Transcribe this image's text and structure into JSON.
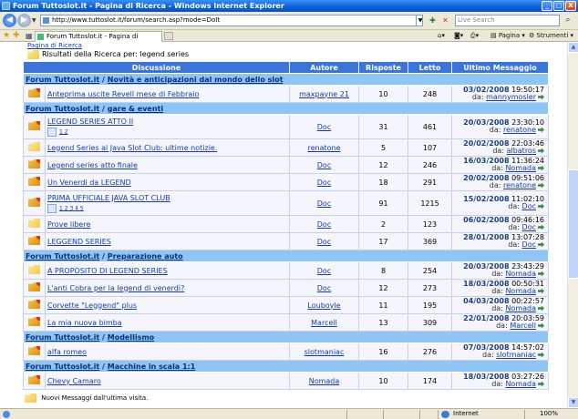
{
  "window": {
    "title": "Forum Tuttoslot.it - Pagina di Ricerca - Windows Internet Explorer",
    "minimize": "_",
    "maximize": "□",
    "close": "X"
  },
  "addressbar": {
    "url": "http://www.tuttoslot.it/forum/search.asp?mode=DoIt",
    "search_placeholder": "Live Search"
  },
  "tabs": [
    {
      "label": "Forum Tuttoslot.it - Pagina di Ricerca"
    }
  ],
  "commands": {
    "page": "Pagina",
    "tools": "Strumenti"
  },
  "breadcrumb": "Pagina di Ricerca",
  "results_label": "Risultati della Ricerca per: legend series",
  "table": {
    "headers": {
      "discussion": "Discussione",
      "author": "Autore",
      "replies": "Risposte",
      "read": "Letto",
      "last": "Ultimo Messaggio"
    },
    "by_label": "da:",
    "sections": [
      {
        "forum": "Forum Tuttoslot.it",
        "category": "Novità e anticipazioni dal mondo dello slot",
        "topics": [
          {
            "icon": "hot",
            "title": "Anteprima uscite Revell mese di Febbraio",
            "pages": "",
            "author": "maxpayne 21",
            "replies": "10",
            "read": "248",
            "date": "03/02/2008",
            "time": "19:50:17",
            "last_author": "mannymosler"
          }
        ]
      },
      {
        "forum": "Forum Tuttoslot.it",
        "category": "gare & eventi",
        "topics": [
          {
            "icon": "hot",
            "title": "LEGEND SERIES ATTO II",
            "pages": "1 2",
            "author": "Doc",
            "replies": "31",
            "read": "461",
            "date": "20/03/2008",
            "time": "23:30:10",
            "last_author": "renatone"
          },
          {
            "icon": "plain",
            "title": "Legend Series al Java Slot Club: ultime notizie.",
            "pages": "",
            "author": "renatone",
            "replies": "5",
            "read": "107",
            "date": "20/02/2008",
            "time": "22:03:46",
            "last_author": "albatros"
          },
          {
            "icon": "hot",
            "title": "Legend series atto finale",
            "pages": "",
            "author": "Doc",
            "replies": "12",
            "read": "246",
            "date": "16/03/2008",
            "time": "11:36:24",
            "last_author": "Nomada"
          },
          {
            "icon": "hot",
            "title": "Un Venerdi da LEGEND",
            "pages": "",
            "author": "Doc",
            "replies": "18",
            "read": "291",
            "date": "20/02/2008",
            "time": "09:51:06",
            "last_author": "renatone"
          },
          {
            "icon": "hot",
            "title": "PRIMA UFFICIALE JAVA SLOT CLUB",
            "pages": "1 2 3 4 5",
            "author": "Doc",
            "replies": "91",
            "read": "1215",
            "date": "15/02/2008",
            "time": "11:02:10",
            "last_author": "Doc"
          },
          {
            "icon": "plain",
            "title": "Prove libere",
            "pages": "",
            "author": "Doc",
            "replies": "2",
            "read": "123",
            "date": "06/02/2008",
            "time": "09:46:16",
            "last_author": "Doc"
          },
          {
            "icon": "hot",
            "title": "LEGGEND SERIES",
            "pages": "",
            "author": "Doc",
            "replies": "17",
            "read": "369",
            "date": "28/01/2008",
            "time": "13:07:28",
            "last_author": "Doc"
          }
        ]
      },
      {
        "forum": "Forum Tuttoslot.it",
        "category": "Preparazione auto",
        "topics": [
          {
            "icon": "plain",
            "title": "A PROPOSITO DI LEGEND SERIES",
            "pages": "",
            "author": "Doc",
            "replies": "8",
            "read": "254",
            "date": "20/03/2008",
            "time": "23:43:29",
            "last_author": "Nomada"
          },
          {
            "icon": "hot",
            "title": "L'anti Cobra per la legend di venerdì?",
            "pages": "",
            "author": "Doc",
            "replies": "12",
            "read": "273",
            "date": "18/03/2008",
            "time": "00:50:31",
            "last_author": "Nomada"
          },
          {
            "icon": "hot",
            "title": "Corvette \"Leggend\" plus",
            "pages": "",
            "author": "Louboyle",
            "replies": "11",
            "read": "195",
            "date": "04/03/2008",
            "time": "00:22:57",
            "last_author": "Nomada"
          },
          {
            "icon": "hot",
            "title": "La mia nuova bimba",
            "pages": "",
            "author": "Marcell",
            "replies": "13",
            "read": "309",
            "date": "22/01/2008",
            "time": "20:03:59",
            "last_author": "Marcell"
          }
        ]
      },
      {
        "forum": "Forum Tuttoslot.it",
        "category": "Modellismo",
        "topics": [
          {
            "icon": "hot",
            "title": "alfa romeo",
            "pages": "",
            "author": "slotmaniac",
            "replies": "16",
            "read": "276",
            "date": "07/03/2008",
            "time": "14:57:02",
            "last_author": "slotmaniac"
          }
        ]
      },
      {
        "forum": "Forum Tuttoslot.it",
        "category": "Macchine in scala 1:1",
        "topics": [
          {
            "icon": "hot",
            "title": "Chevy Camaro",
            "pages": "",
            "author": "Nomada",
            "replies": "10",
            "read": "174",
            "date": "18/03/2008",
            "time": "03:27:26",
            "last_author": "Nomada"
          }
        ]
      }
    ]
  },
  "legend_note": "Nuovi Messaggi dall'ultima visita.",
  "statusbar": {
    "zone": "Internet",
    "zoom": "100%"
  }
}
